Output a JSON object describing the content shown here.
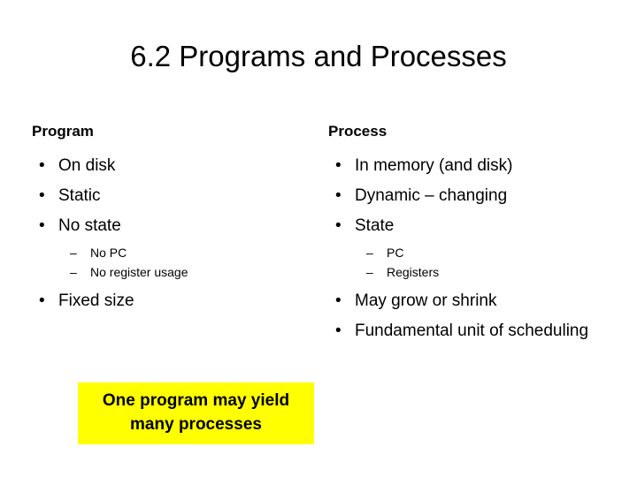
{
  "slide": {
    "title": "6.2 Programs and Processes",
    "background_color": "#FFFFFF",
    "text_color": "#000000"
  },
  "left_column": {
    "heading": "Program",
    "bullet_marker": "•",
    "sub_marker": "–",
    "items": [
      {
        "text": "On disk"
      },
      {
        "text": "Static"
      },
      {
        "text": "No state"
      }
    ],
    "sub_items": [
      {
        "text": "No PC"
      },
      {
        "text": "No register usage"
      }
    ],
    "items_after": [
      {
        "text": "Fixed size"
      }
    ]
  },
  "right_column": {
    "heading": "Process",
    "bullet_marker": "•",
    "sub_marker": "–",
    "items": [
      {
        "text": "In memory (and disk)"
      },
      {
        "text": "Dynamic – changing"
      },
      {
        "text": "State"
      }
    ],
    "sub_items": [
      {
        "text": "PC"
      },
      {
        "text": "Registers"
      }
    ],
    "items_after": [
      {
        "text": "May grow or shrink"
      },
      {
        "text": "Fundamental unit of scheduling"
      }
    ]
  },
  "callout": {
    "text": "One program may yield many processes",
    "background_color": "#FFFF00",
    "text_color": "#000000"
  }
}
